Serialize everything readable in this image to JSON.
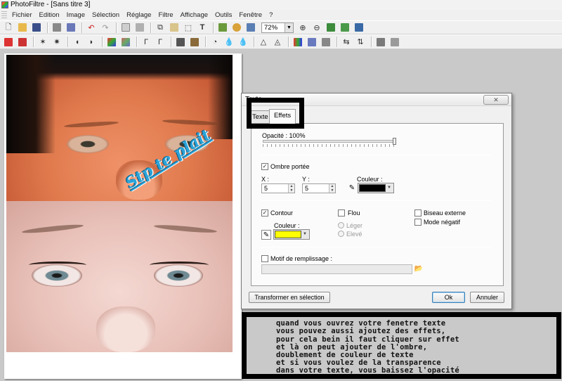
{
  "window": {
    "title": "PhotoFiltre - [Sans titre 3]"
  },
  "menu": [
    "Fichier",
    "Edition",
    "Image",
    "Sélection",
    "Réglage",
    "Filtre",
    "Affichage",
    "Outils",
    "Fenêtre",
    "?"
  ],
  "toolbar": {
    "zoom": "72%"
  },
  "canvas": {
    "watermark_text": "Stp te plait"
  },
  "dialog": {
    "title": "Texte",
    "tabs": [
      "Texte",
      "Effets"
    ],
    "active_tab": "Effets",
    "opacity_label": "Opacité : 100%",
    "opacity_value": 1.0,
    "shadow": {
      "label": "Ombre portée",
      "checked": "✓",
      "x_label": "X :",
      "y_label": "Y :",
      "x_value": "5",
      "y_value": "5",
      "color_label": "Couleur :",
      "color": "#000000"
    },
    "contour": {
      "label": "Contour",
      "checked": "✓",
      "color_label": "Couleur :",
      "color": "#ffff00"
    },
    "flou": {
      "label": "Flou",
      "options": [
        "Léger",
        "Elevé"
      ]
    },
    "biseau_label": "Biseau externe",
    "negatif_label": "Mode négatif",
    "motif_label": "Motif de remplissage :",
    "transform_button": "Transformer en sélection",
    "ok_button": "Ok",
    "cancel_button": "Annuler"
  },
  "callout": {
    "lines": [
      "quand vous ouvrez votre fenetre texte",
      "vous pouvez aussi ajoutez des effets,",
      "pour cela bein il faut cliquer sur effet",
      "et là on peut ajouter de l'ombre,",
      "doublement de couleur de texte",
      "et si vous voulez de la transparence",
      "dans votre texte, vous baissez l'opacité"
    ]
  },
  "colors": {
    "highlight_border": "#000000",
    "watermark": "#2aa3d8",
    "ok_focus": "#3c7fb1"
  }
}
